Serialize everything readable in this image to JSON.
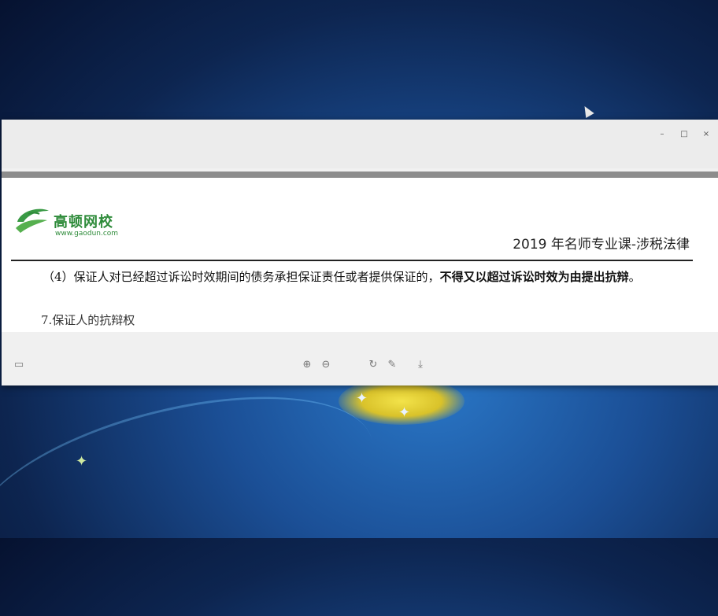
{
  "window": {
    "controls": {
      "minimize": "–",
      "maximize": "□",
      "close": "×"
    }
  },
  "document": {
    "logo": {
      "name": "高顿网校",
      "url": "www.gaodun.com"
    },
    "header_right": "2019 年名师专业课-涉税法律",
    "paragraph": {
      "normal": "（4）保证人对已经超过诉讼时效期间的债务承担保证责任或者提供保证的，",
      "bold": "不得又以超过诉讼时效为由提出抗辩",
      "end": "。"
    },
    "next_line": "7.保证人的抗辩权"
  },
  "viewer_toolbar": {
    "icons": [
      "layout-icon",
      "zoom-in-icon",
      "zoom-out-icon",
      "rotate-icon",
      "edit-icon",
      "download-icon"
    ],
    "glyphs": {
      "layout": "▭",
      "zoom_in": "⊕",
      "zoom_out": "⊖",
      "rotate": "↻",
      "edit": "✎",
      "download": "⤓"
    }
  },
  "colors": {
    "logo_green": "#2e8b3a",
    "window_bg": "#f1f1f1"
  }
}
